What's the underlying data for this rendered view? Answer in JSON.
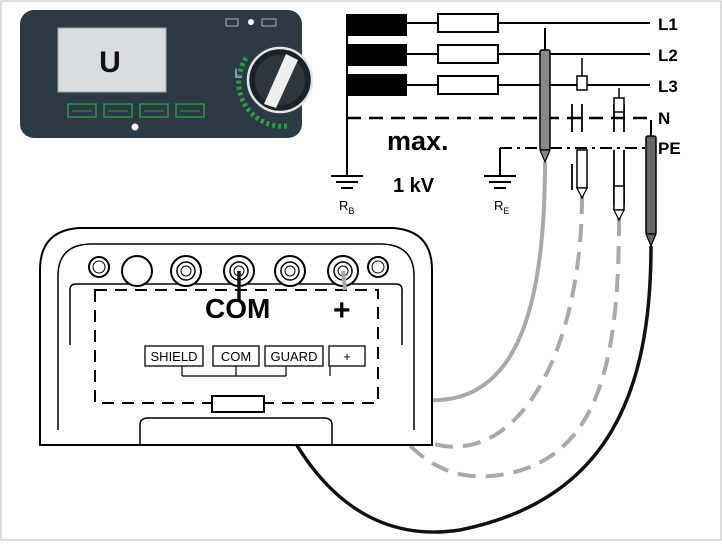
{
  "meter": {
    "display_text": "U",
    "softkeys": [
      "",
      "",
      "",
      ""
    ]
  },
  "lines": {
    "l1": "L1",
    "l2": "L2",
    "l3": "L3",
    "n": "N",
    "pe": "PE"
  },
  "ground": {
    "rb_main": "R",
    "rb_sub": "B",
    "re_main": "R",
    "re_sub": "E"
  },
  "limit": {
    "line1": "max.",
    "line2": "1 kV"
  },
  "terminals": {
    "com_large": "COM",
    "plus_large": "+",
    "labels": [
      "SHIELD",
      "COM",
      "GUARD",
      "+"
    ]
  },
  "colors": {
    "probe_gray": "#a9a9a9",
    "probe_black": "#111111",
    "meter_body": "#2c3a44",
    "display": "#d9dde0",
    "softkey_green": "#2e9c4f"
  }
}
